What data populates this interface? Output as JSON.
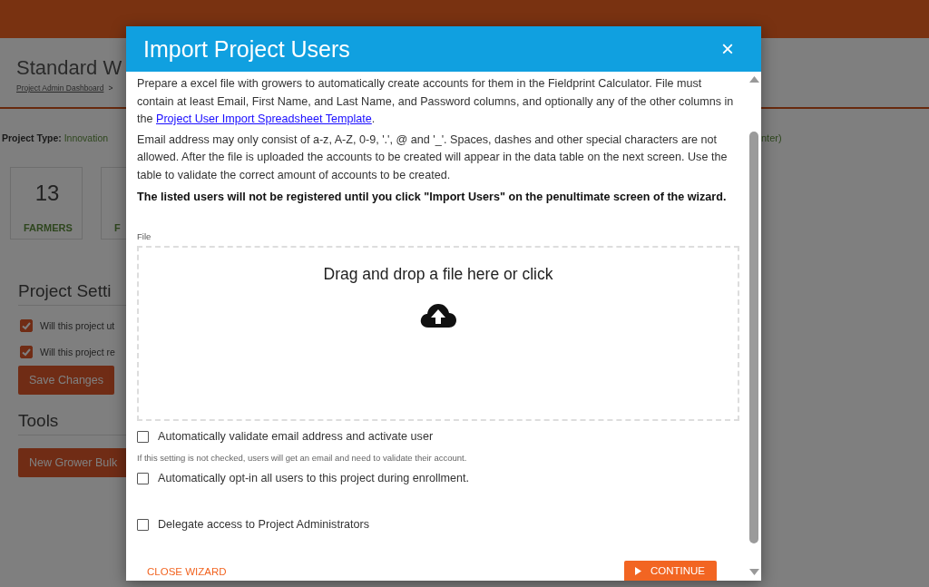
{
  "background": {
    "page_title": "Standard W",
    "breadcrumb": {
      "link": "Project Admin Dashboard",
      "separator": ">"
    },
    "project_type": {
      "label": "Project Type:",
      "value": "Innovation"
    },
    "right_fragment": "nter)",
    "stats": [
      {
        "value": "13",
        "label": "FARMERS"
      },
      {
        "label": "F"
      }
    ],
    "settings_heading": "Project Setti",
    "settings": [
      {
        "label": "Will this project ut",
        "checked": true
      },
      {
        "label": "Will this project re",
        "checked": true
      }
    ],
    "save_button": "Save Changes",
    "tools_heading": "Tools",
    "tools_button": "New Grower Bulk"
  },
  "modal": {
    "title": "Import Project Users",
    "close": "×",
    "intro": {
      "before": "Prepare a excel file with growers to automatically create accounts for them in the Fieldprint Calculator. File must contain at least Email, First Name, and Last Name, and Password columns, and optionally any of the other columns in the ",
      "link": "Project User Import Spreadsheet Template",
      "after": "."
    },
    "rules": "Email address may only consist of a-z, A-Z, 0-9, '.', @ and '_'. Spaces, dashes and other special characters are not allowed. After the file is uploaded the accounts to be created will appear in the data table on the next screen. Use the table to validate the correct amount of accounts to be created.",
    "notice": "The listed users will not be registered until you click \"Import Users\" on the penultimate screen of the wizard.",
    "file_label": "File",
    "dropzone": "Drag and drop a file here or click",
    "options": [
      {
        "label": "Automatically validate email address and activate user",
        "checked": false,
        "hint": "If this setting is not checked, users will get an email and need to validate their account."
      },
      {
        "label": "Automatically opt-in all users to this project during enrollment.",
        "checked": false
      },
      {
        "label": "Delegate access to Project Administrators",
        "checked": false
      }
    ],
    "close_wizard": "CLOSE WIZARD",
    "continue": "CONTINUE"
  }
}
